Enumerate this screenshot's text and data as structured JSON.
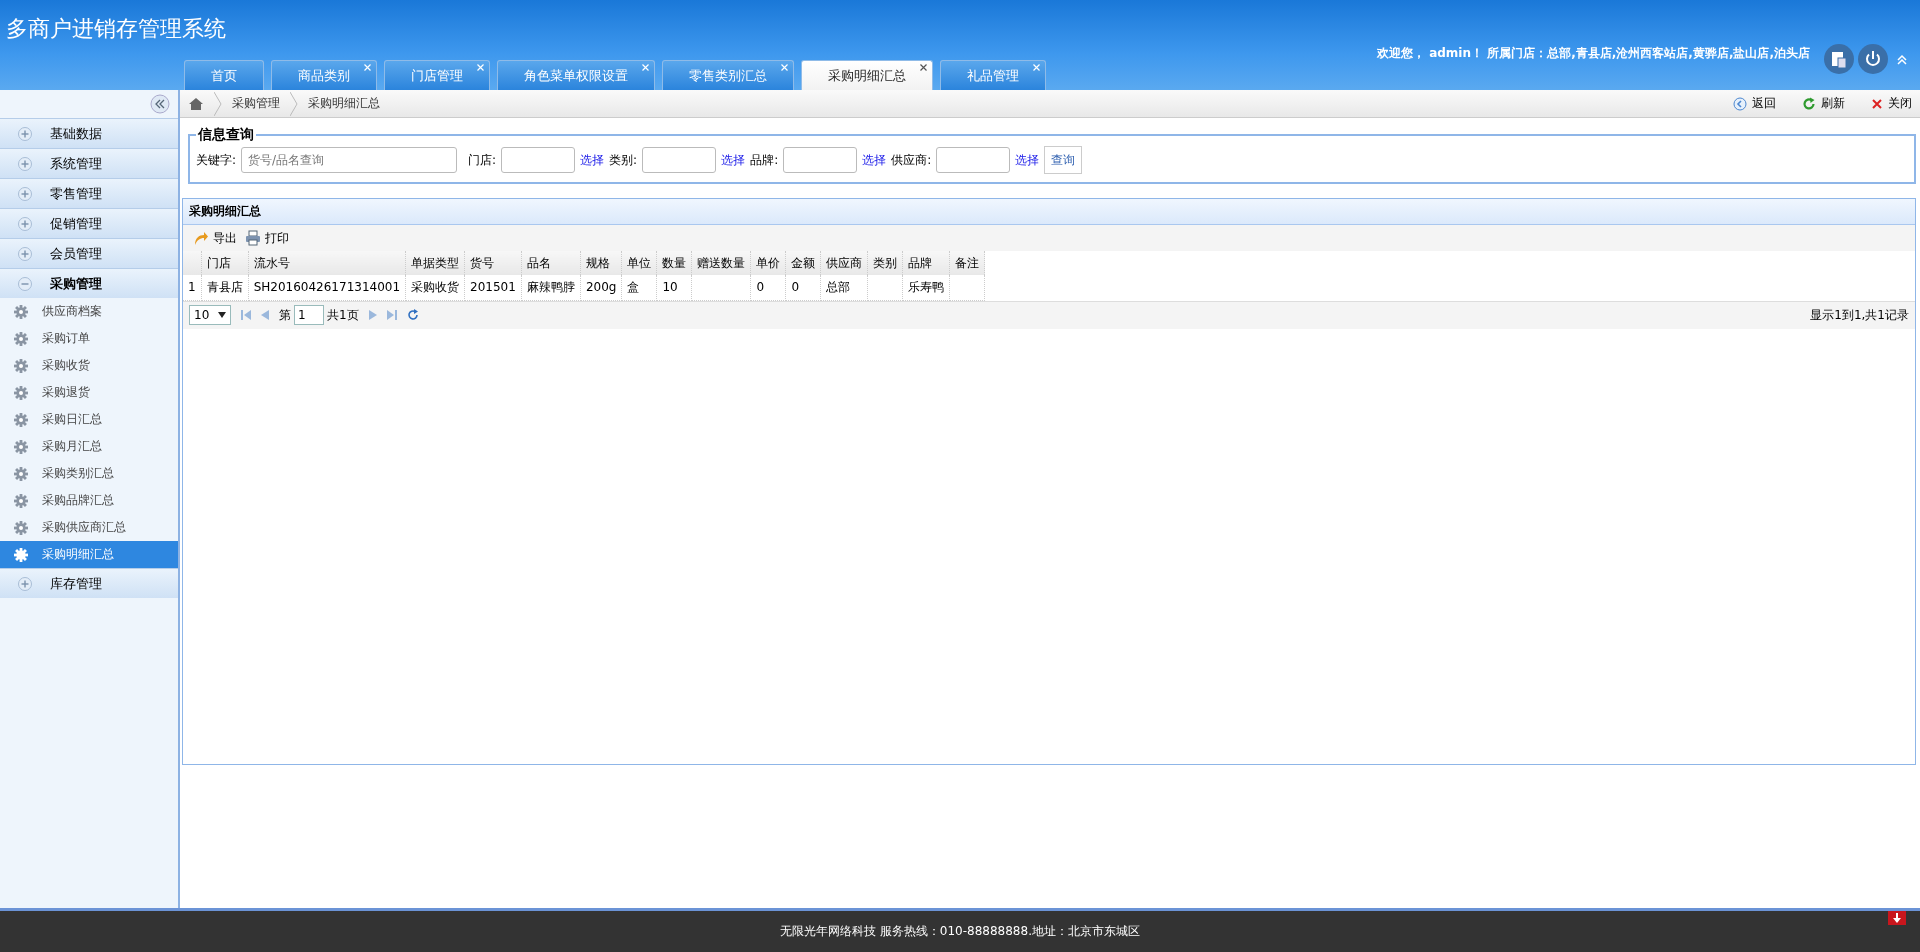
{
  "header": {
    "title": "多商户进销存管理系统",
    "welcome": "欢迎您， admin！ 所属门店：总部,青县店,沧州西客站店,黄骅店,盐山店,泊头店"
  },
  "tabs": [
    {
      "label": "首页",
      "closable": false,
      "selected": false
    },
    {
      "label": "商品类别",
      "closable": true,
      "selected": false
    },
    {
      "label": "门店管理",
      "closable": true,
      "selected": false
    },
    {
      "label": "角色菜单权限设置",
      "closable": true,
      "selected": false
    },
    {
      "label": "零售类别汇总",
      "closable": true,
      "selected": false
    },
    {
      "label": "采购明细汇总",
      "closable": true,
      "selected": true
    },
    {
      "label": "礼品管理",
      "closable": true,
      "selected": false
    }
  ],
  "breadcrumb": [
    "采购管理",
    "采购明细汇总"
  ],
  "page_actions": [
    {
      "kind": "back",
      "label": "返回"
    },
    {
      "kind": "refresh",
      "label": "刷新"
    },
    {
      "kind": "close",
      "label": "关闭"
    }
  ],
  "sidebar": {
    "groups": [
      {
        "label": "基础数据",
        "expanded": false
      },
      {
        "label": "系统管理",
        "expanded": false
      },
      {
        "label": "零售管理",
        "expanded": false
      },
      {
        "label": "促销管理",
        "expanded": false
      },
      {
        "label": "会员管理",
        "expanded": false
      },
      {
        "label": "采购管理",
        "expanded": true,
        "children": [
          {
            "label": "供应商档案",
            "selected": false
          },
          {
            "label": "采购订单",
            "selected": false
          },
          {
            "label": "采购收货",
            "selected": false
          },
          {
            "label": "采购退货",
            "selected": false
          },
          {
            "label": "采购日汇总",
            "selected": false
          },
          {
            "label": "采购月汇总",
            "selected": false
          },
          {
            "label": "采购类别汇总",
            "selected": false
          },
          {
            "label": "采购品牌汇总",
            "selected": false
          },
          {
            "label": "采购供应商汇总",
            "selected": false
          },
          {
            "label": "采购明细汇总",
            "selected": true
          }
        ]
      },
      {
        "label": "库存管理",
        "expanded": false
      }
    ]
  },
  "query": {
    "legend": "信息查询",
    "keyword_label": "关键字:",
    "keyword_placeholder": "货号/品名查询",
    "filters": [
      {
        "label": "门店:",
        "pick": "选择"
      },
      {
        "label": "类别:",
        "pick": "选择"
      },
      {
        "label": "品牌:",
        "pick": "选择"
      },
      {
        "label": "供应商:",
        "pick": "选择"
      }
    ],
    "search_button": "查询"
  },
  "grid": {
    "title": "采购明细汇总",
    "toolbar": [
      {
        "kind": "export",
        "label": "导出"
      },
      {
        "kind": "print",
        "label": "打印"
      }
    ],
    "columns": [
      "门店",
      "流水号",
      "单据类型",
      "货号",
      "品名",
      "规格",
      "单位",
      "数量",
      "赠送数量",
      "单价",
      "金额",
      "供应商",
      "类别",
      "品牌",
      "备注"
    ],
    "rows": [
      {
        "number": "1",
        "cells": [
          "青县店",
          "SH20160426171314001",
          "采购收货",
          "201501",
          "麻辣鸭脖",
          "200g",
          "盒",
          "10",
          "",
          "0",
          "0",
          "总部",
          "",
          "乐寿鸭",
          ""
        ]
      }
    ],
    "pager": {
      "page_size": "10",
      "page_prefix": "第",
      "page": "1",
      "page_total": "共1页",
      "summary": "显示1到1,共1记录"
    }
  },
  "footer": "无限光年网络科技 服务热线：010-88888888.地址：北京市东城区"
}
